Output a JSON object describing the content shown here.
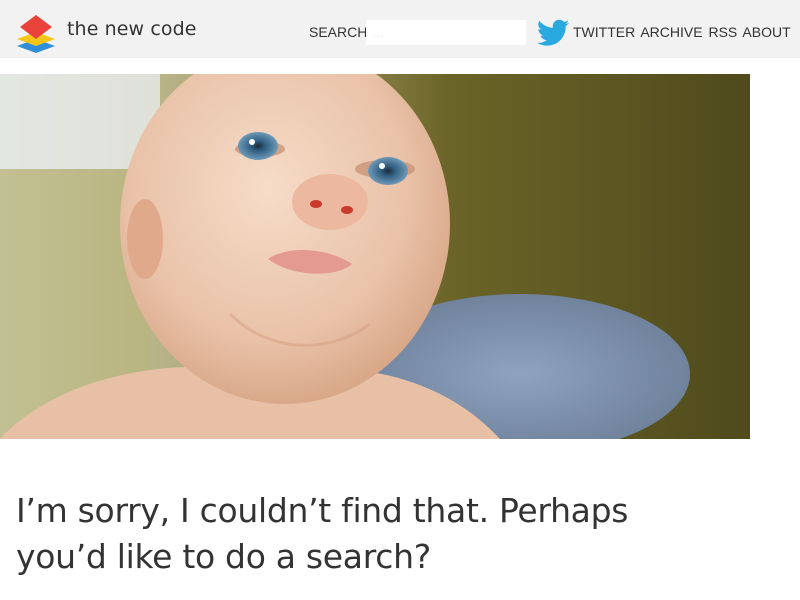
{
  "site": {
    "title": "the new code",
    "logo_icon": "stacked-diamonds-logo",
    "logo_colors": [
      "#e8423b",
      "#f5c518",
      "#2f8fd8"
    ]
  },
  "search": {
    "label": "SEARCH",
    "value": "",
    "placeholder": "…"
  },
  "nav": {
    "twitter_icon": "twitter-bird-icon",
    "twitter_color": "#2aa9e0",
    "items": [
      {
        "label": "TWITTER"
      },
      {
        "label": "ARCHIVE"
      },
      {
        "label": "RSS"
      },
      {
        "label": "ABOUT"
      }
    ]
  },
  "hero": {
    "subject": "crying-baby-photo"
  },
  "message": {
    "text": "I’m sorry, I couldn’t find that. Perhaps you’d like to do a search?"
  }
}
